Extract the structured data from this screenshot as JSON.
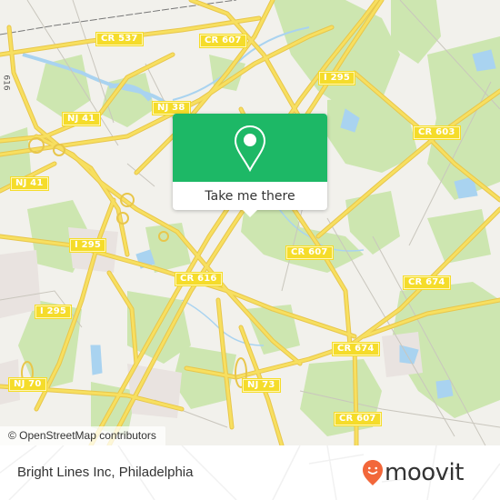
{
  "map": {
    "colors": {
      "background": "#f2f1ec",
      "park": "#cde6b0",
      "water": "#a9d3f0",
      "road": "#f7df60",
      "road_outline": "#e8c64a",
      "minor_road": "#c9c6bd",
      "residential": "#e9e3e0",
      "label_bg": "#f5dc2a"
    },
    "road_labels": [
      {
        "id": "cr537",
        "text": "CR 537"
      },
      {
        "id": "cr607-top",
        "text": "CR 607"
      },
      {
        "id": "nj38",
        "text": "NJ 38"
      },
      {
        "id": "nj41-a",
        "text": "NJ 41"
      },
      {
        "id": "nj41-b",
        "text": "NJ 41"
      },
      {
        "id": "i295-top",
        "text": "I 295"
      },
      {
        "id": "cr603",
        "text": "CR 603"
      },
      {
        "id": "i295-mid",
        "text": "I 295"
      },
      {
        "id": "cr616",
        "text": "CR 616"
      },
      {
        "id": "cr607-mid",
        "text": "CR 607"
      },
      {
        "id": "cr674-right",
        "text": "CR 674"
      },
      {
        "id": "i295-low",
        "text": "I 295"
      },
      {
        "id": "cr674-mid",
        "text": "CR 674"
      },
      {
        "id": "nj70",
        "text": "NJ 70"
      },
      {
        "id": "nj73",
        "text": "NJ 73"
      },
      {
        "id": "cr607-bottom",
        "text": "CR 607"
      }
    ],
    "side_text": "616",
    "attribution": "© OpenStreetMap contributors"
  },
  "popup": {
    "button_label": "Take me there",
    "accent": "#1db866"
  },
  "footer": {
    "place_name": "Bright Lines Inc, Philadelphia",
    "brand": "moovit",
    "brand_color": "#f2673a"
  }
}
